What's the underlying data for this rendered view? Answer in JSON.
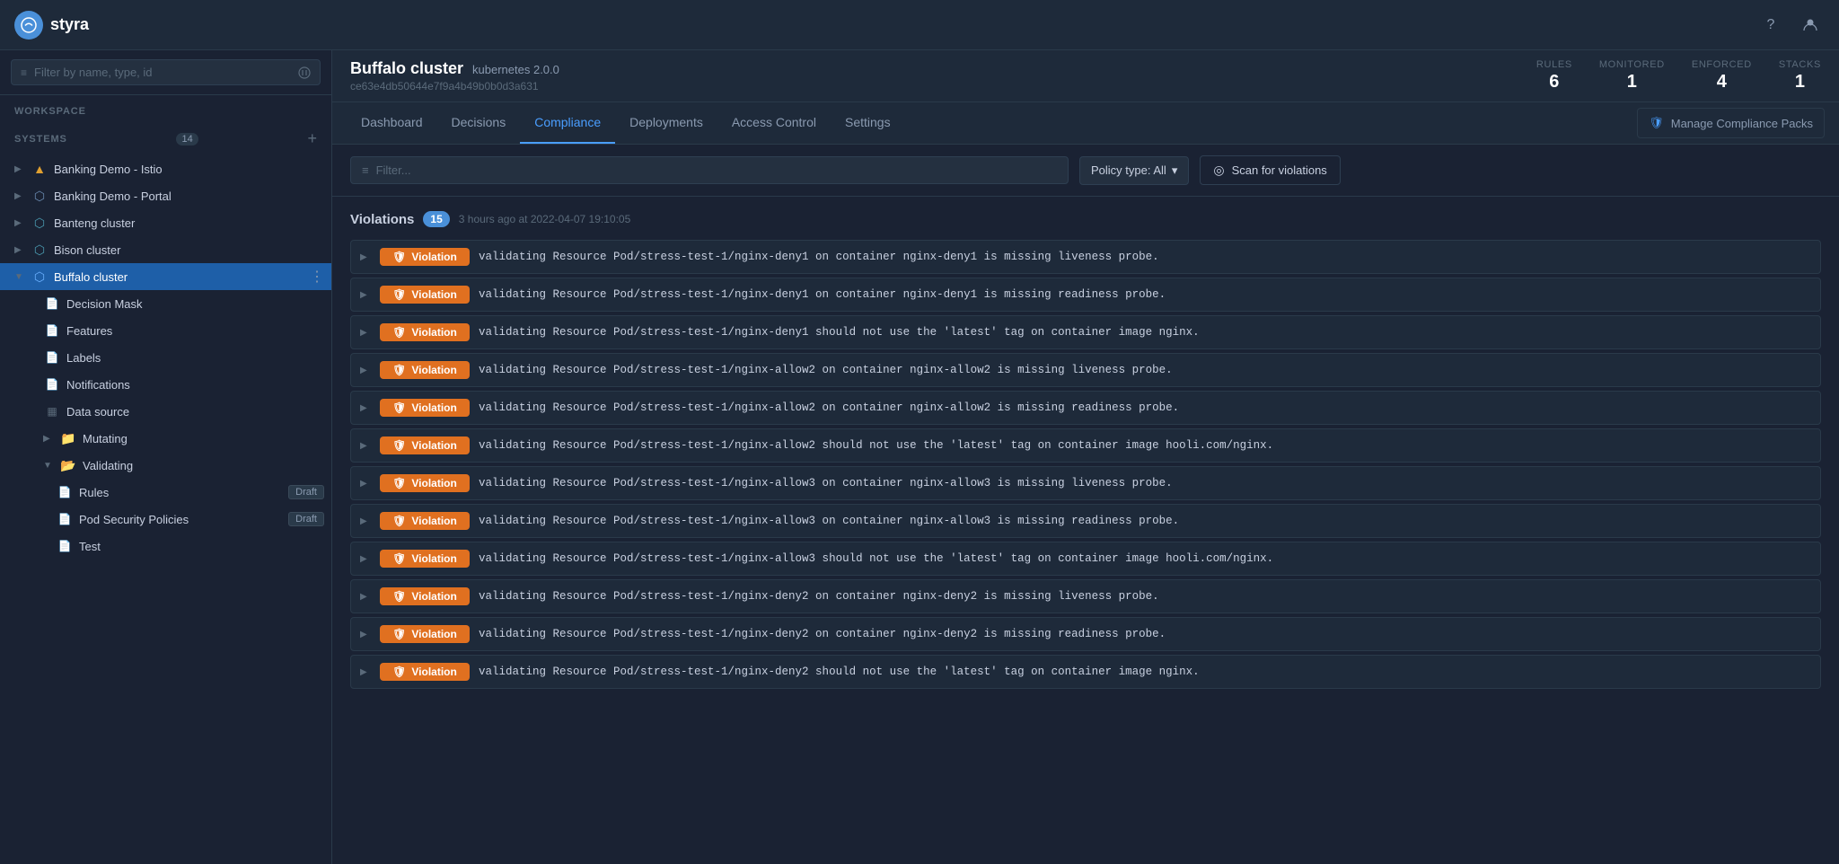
{
  "app": {
    "name": "styra",
    "logo_letter": "S"
  },
  "header": {
    "search_placeholder": "Filter by name, type, id"
  },
  "cluster": {
    "name": "Buffalo cluster",
    "platform": "kubernetes 2.0.0",
    "id": "ce63e4db50644e7f9a4b49b0b0d3a631",
    "stats": {
      "rules_label": "RULES",
      "rules_value": "6",
      "monitored_label": "MONITORED",
      "monitored_value": "1",
      "enforced_label": "ENFORCED",
      "enforced_value": "4",
      "stacks_label": "STACKS",
      "stacks_value": "1"
    }
  },
  "tabs": {
    "items": [
      "Dashboard",
      "Decisions",
      "Compliance",
      "Deployments",
      "Access Control",
      "Settings"
    ],
    "active": "Compliance",
    "manage_label": "Manage Compliance Packs"
  },
  "filter": {
    "placeholder": "Filter...",
    "policy_type_label": "Policy type: All",
    "scan_label": "Scan for violations"
  },
  "violations": {
    "title": "Violations",
    "count": "15",
    "time": "3 hours ago at 2022-04-07 19:10:05",
    "rows": [
      {
        "type": "Violation",
        "text": "validating   Resource Pod/stress-test-1/nginx-deny1 on container nginx-deny1 is missing liveness probe."
      },
      {
        "type": "Violation",
        "text": "validating   Resource Pod/stress-test-1/nginx-deny1 on container nginx-deny1 is missing readiness probe."
      },
      {
        "type": "Violation",
        "text": "validating   Resource Pod/stress-test-1/nginx-deny1 should not use the 'latest' tag on container image nginx."
      },
      {
        "type": "Violation",
        "text": "validating   Resource Pod/stress-test-1/nginx-allow2 on container nginx-allow2 is missing liveness probe."
      },
      {
        "type": "Violation",
        "text": "validating   Resource Pod/stress-test-1/nginx-allow2 on container nginx-allow2 is missing readiness probe."
      },
      {
        "type": "Violation",
        "text": "validating   Resource Pod/stress-test-1/nginx-allow2 should not use the 'latest' tag on container image hooli.com/nginx."
      },
      {
        "type": "Violation",
        "text": "validating   Resource Pod/stress-test-1/nginx-allow3 on container nginx-allow3 is missing liveness probe."
      },
      {
        "type": "Violation",
        "text": "validating   Resource Pod/stress-test-1/nginx-allow3 on container nginx-allow3 is missing readiness probe."
      },
      {
        "type": "Violation",
        "text": "validating   Resource Pod/stress-test-1/nginx-allow3 should not use the 'latest' tag on container image hooli.com/nginx."
      },
      {
        "type": "Violation",
        "text": "validating   Resource Pod/stress-test-1/nginx-deny2 on container nginx-deny2 is missing liveness probe."
      },
      {
        "type": "Violation",
        "text": "validating   Resource Pod/stress-test-1/nginx-deny2 on container nginx-deny2 is missing readiness probe."
      },
      {
        "type": "Violation",
        "text": "validating   Resource Pod/stress-test-1/nginx-deny2 should not use the 'latest' tag on container image nginx."
      }
    ]
  },
  "sidebar": {
    "workspace_label": "WORKSPACE",
    "systems_label": "SYSTEMS",
    "systems_count": "14",
    "items": [
      {
        "id": "banking-istio",
        "label": "Banking Demo - Istio",
        "type": "system",
        "expanded": false
      },
      {
        "id": "banking-portal",
        "label": "Banking Demo - Portal",
        "type": "system",
        "expanded": false
      },
      {
        "id": "banteng",
        "label": "Banteng cluster",
        "type": "system",
        "expanded": false
      },
      {
        "id": "bison",
        "label": "Bison cluster",
        "type": "system",
        "expanded": false
      },
      {
        "id": "buffalo",
        "label": "Buffalo cluster",
        "type": "system",
        "expanded": true,
        "active": true
      }
    ],
    "buffalo_children": [
      {
        "id": "decision-mask",
        "label": "Decision Mask"
      },
      {
        "id": "features",
        "label": "Features"
      },
      {
        "id": "labels",
        "label": "Labels"
      },
      {
        "id": "notifications",
        "label": "Notifications"
      },
      {
        "id": "data-source",
        "label": "Data source",
        "icon": "table"
      }
    ],
    "mutating": {
      "label": "Mutating",
      "expanded": false
    },
    "validating": {
      "label": "Validating",
      "expanded": true,
      "children": [
        {
          "id": "rules",
          "label": "Rules",
          "badge": "Draft"
        },
        {
          "id": "pod-security-policies",
          "label": "Pod Security Policies",
          "badge": "Draft"
        },
        {
          "id": "test",
          "label": "Test"
        }
      ]
    }
  }
}
